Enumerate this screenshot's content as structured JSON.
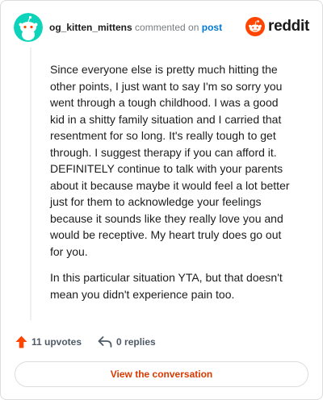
{
  "comment": {
    "author": "og_kitten_mittens",
    "action_text": "commented on",
    "post_link": "post",
    "paragraphs": [
      "Since everyone else is pretty much hitting the other points, I just want to say I'm so sorry you went through a tough childhood. I was a good kid in a shitty family situation and I carried that resentment for so long. It's really tough to get through. I suggest therapy if you can afford it. DEFINITELY continue to talk with your parents about it because maybe it would feel a lot better just for them to acknowledge your feelings because it sounds like they really love you and would be receptive. My heart truly does go out for you.",
      "In this particular situation YTA, but that doesn't mean you didn't experience pain too."
    ]
  },
  "brand": {
    "name": "reddit",
    "color": "#ff4500"
  },
  "footer": {
    "upvotes_label": "11 upvotes",
    "replies_label": "0 replies",
    "view_button": "View the conversation"
  },
  "colors": {
    "accent": "#d93a00",
    "upvote": "#ff4500",
    "link": "#0079d3",
    "avatar_bg": "#0dd3bb"
  },
  "icons": {
    "upvote": "upvote-arrow-icon",
    "reply": "reply-arrow-icon",
    "brand": "reddit-snoo-icon"
  }
}
